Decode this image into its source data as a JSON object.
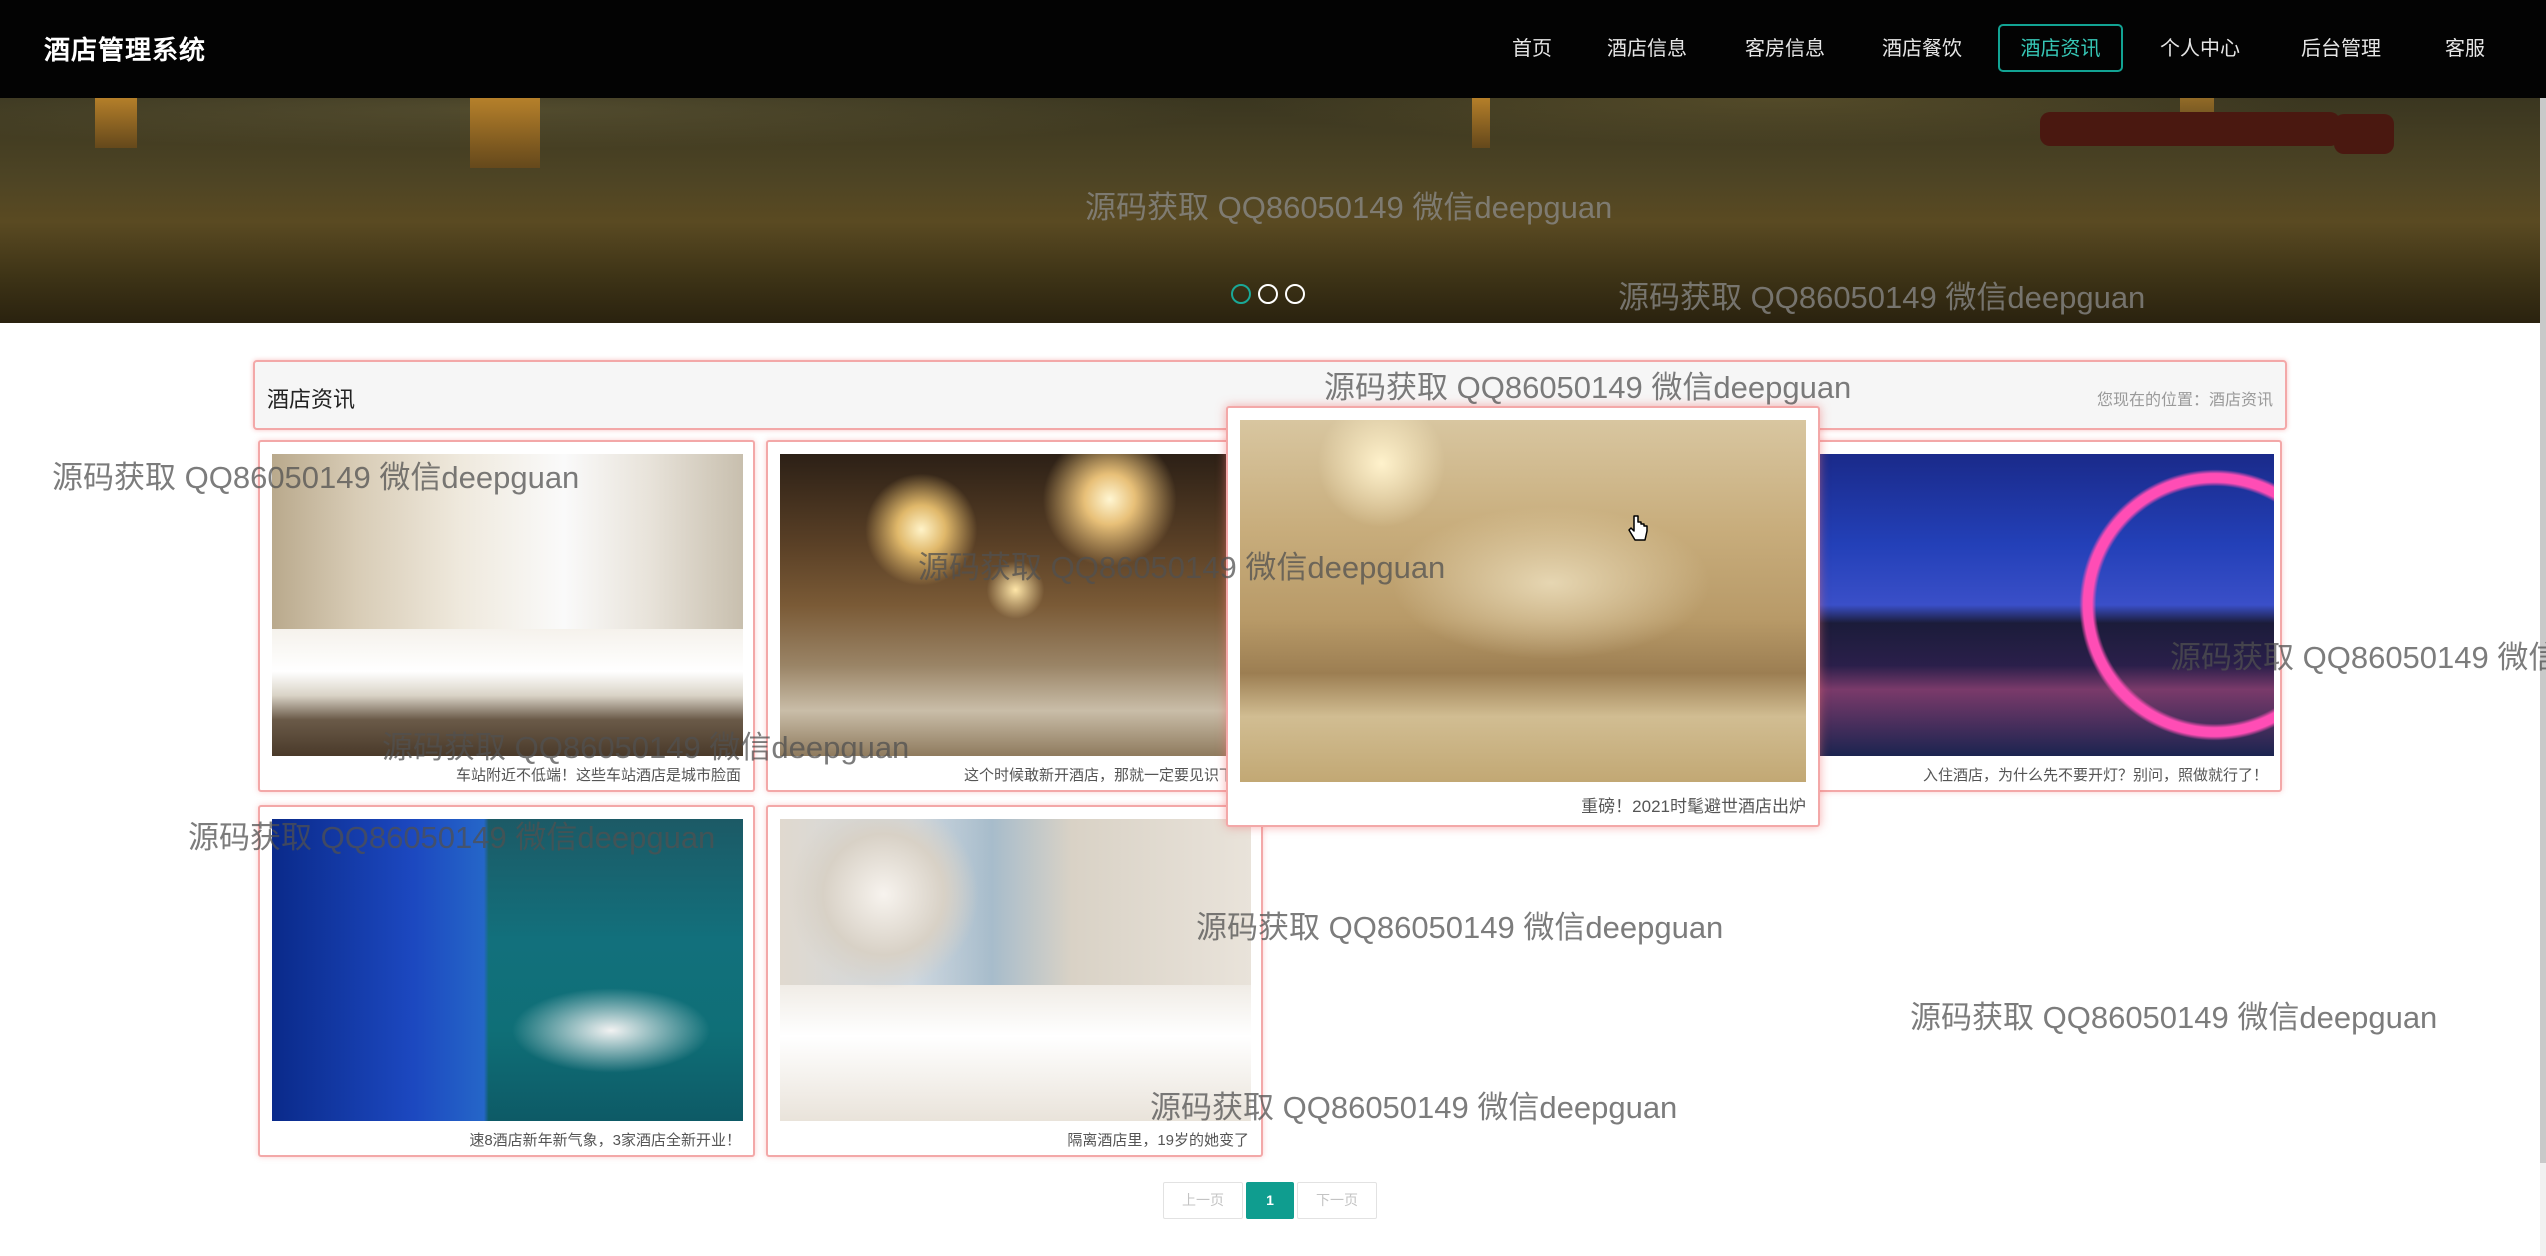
{
  "header": {
    "brand": "酒店管理系统",
    "nav": [
      {
        "label": "首页",
        "active": false
      },
      {
        "label": "酒店信息",
        "active": false
      },
      {
        "label": "客房信息",
        "active": false
      },
      {
        "label": "酒店餐饮",
        "active": false
      },
      {
        "label": "酒店资讯",
        "active": true
      },
      {
        "label": "个人中心",
        "active": false
      },
      {
        "label": "后台管理",
        "active": false
      },
      {
        "label": "客服",
        "active": false
      }
    ]
  },
  "banner": {
    "slides": 3,
    "active_slide": 1
  },
  "section": {
    "title": "酒店资讯",
    "breadcrumb": "您现在的位置：酒店资讯"
  },
  "news": [
    {
      "caption": "车站附近不低端！这些车站酒店是城市脸面",
      "image": "hotel-room-photo"
    },
    {
      "caption": "这个时候敢新开酒店，那就一定要见识下了",
      "image": "banquet-hall-photo"
    },
    {
      "caption": "重磅！2021时髦避世酒店出炉",
      "image": "classic-suite-photo"
    },
    {
      "caption": "入住酒店，为什么先不要开灯？别问，照做就行了！",
      "image": "city-night-view-photo"
    },
    {
      "caption": "速8酒店新年新气象，3家酒店全新开业！",
      "image": "teal-room-photo"
    },
    {
      "caption": "隔离酒店里，19岁的她变了",
      "image": "white-room-photo"
    }
  ],
  "pagination": {
    "prev": "上一页",
    "current": "1",
    "next": "下一页"
  },
  "watermark": "源码获取 QQ86050149 微信deepguan",
  "colors": {
    "accent": "#12a393",
    "card_border": "#f3a8a8",
    "header_bg": "#030303"
  }
}
